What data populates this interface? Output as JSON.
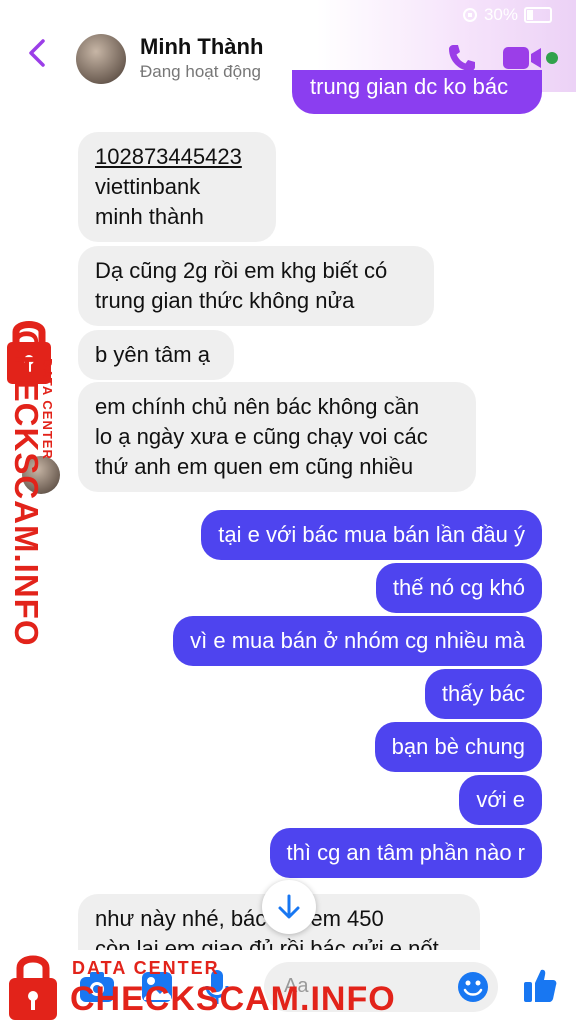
{
  "status": {
    "battery": "30%"
  },
  "header": {
    "contact_name": "Minh Thành",
    "activity": "Đang hoạt động"
  },
  "messages": [
    {
      "dir": "out",
      "text": "trung gian dc ko bác"
    },
    {
      "dir": "in",
      "lines": [
        "102873445423",
        "viettinbank",
        "minh thành"
      ]
    },
    {
      "dir": "in",
      "lines": [
        "Dạ cũng 2g rồi em khg biết có",
        "trung gian thức không nửa"
      ]
    },
    {
      "dir": "in",
      "text": "b yên tâm ạ"
    },
    {
      "dir": "in",
      "lines": [
        "em chính chủ nên bác không cần",
        "lo ạ  ngày xưa e cũng chạy voi các",
        "thứ anh em quen em cũng nhiều"
      ]
    },
    {
      "dir": "out",
      "text": "tại e với bác mua bán lần đầu ý"
    },
    {
      "dir": "out",
      "text": "thế nó cg khó"
    },
    {
      "dir": "out",
      "text": "vì e mua bán ở nhóm cg nhiều mà"
    },
    {
      "dir": "out",
      "text": "thấy bác"
    },
    {
      "dir": "out",
      "text": "bạn bè chung"
    },
    {
      "dir": "out",
      "text": "với e"
    },
    {
      "dir": "out",
      "text": "thì cg an tâm phần nào r"
    },
    {
      "dir": "in",
      "lines": [
        "như này nhé, bác   gửi em 450",
        "còn lại em giao đủ rồi bác gửi e nốt"
      ]
    }
  ],
  "composer": {
    "placeholder": "Aa"
  },
  "watermark": {
    "small": "DATA CENTER",
    "big": "CHECKSCAM.INFO"
  },
  "colors": {
    "outgoing": "#4e44ef",
    "outgoing_top": "#8b3ef0",
    "incoming": "#efefef",
    "accent": "#9b3ee8",
    "composer_icons": "#1877f2",
    "watermark": "#e2231a"
  },
  "icons": [
    "back-chevron-icon",
    "phone-icon",
    "video-camera-icon",
    "camera-icon",
    "image-icon",
    "microphone-icon",
    "emoji-icon",
    "thumbs-up-icon",
    "scroll-down-arrow-icon",
    "lock-icon"
  ]
}
